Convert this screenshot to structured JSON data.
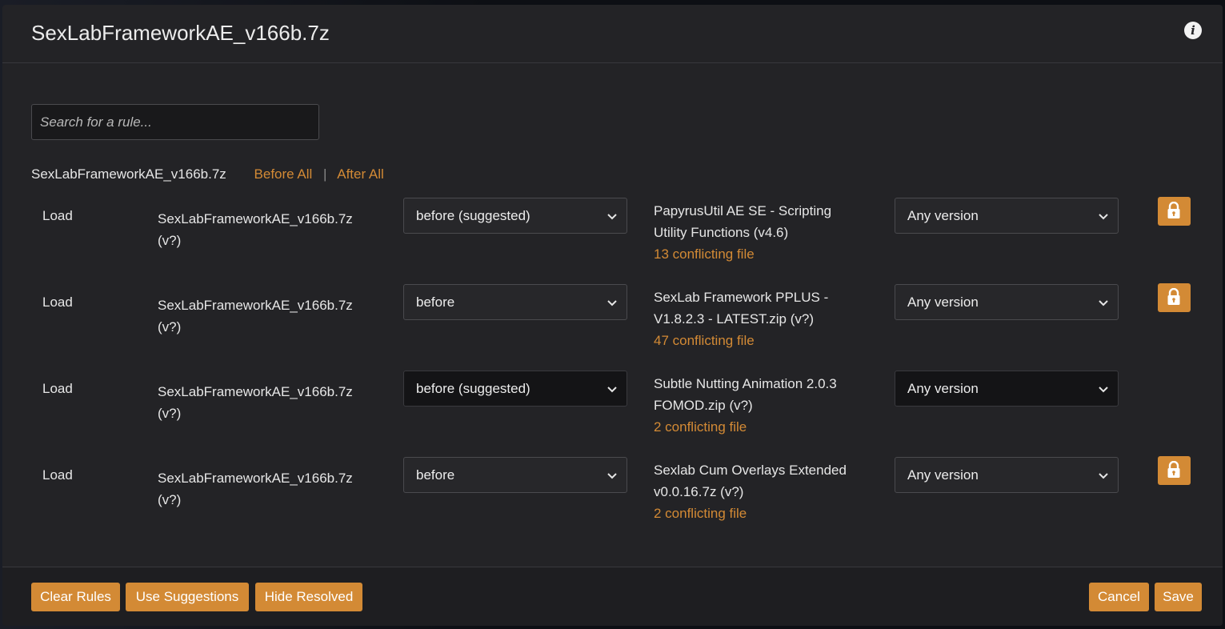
{
  "dialog": {
    "title": "SexLabFrameworkAE_v166b.7z",
    "info_icon": "info-icon"
  },
  "search": {
    "placeholder": "Search for a rule..."
  },
  "subhead": {
    "mod_name": "SexLabFrameworkAE_v166b.7z",
    "before_all": "Before All",
    "separator": "|",
    "after_all": "After All"
  },
  "rules": [
    {
      "verb": "Load",
      "source_name": "SexLabFrameworkAE_v166b.7z",
      "source_version": "(v?)",
      "relation": "before (suggested)",
      "target_line1": "PapyrusUtil AE SE - Scripting",
      "target_line2": "Utility Functions (v4.6)",
      "conflicts": "13 conflicting file",
      "version": "Any version",
      "locked": true
    },
    {
      "verb": "Load",
      "source_name": "SexLabFrameworkAE_v166b.7z",
      "source_version": "(v?)",
      "relation": "before",
      "target_line1": "SexLab Framework PPLUS -",
      "target_line2": "V1.8.2.3 - LATEST.zip (v?)",
      "conflicts": "47 conflicting file",
      "version": "Any version",
      "locked": true
    },
    {
      "verb": "Load",
      "source_name": "SexLabFrameworkAE_v166b.7z",
      "source_version": "(v?)",
      "relation": "before (suggested)",
      "target_line1": "Subtle Nutting Animation 2.0.3",
      "target_line2": "FOMOD.zip (v?)",
      "conflicts": "2 conflicting file",
      "version": "Any version",
      "locked": false
    },
    {
      "verb": "Load",
      "source_name": "SexLabFrameworkAE_v166b.7z",
      "source_version": "(v?)",
      "relation": "before",
      "target_line1": "Sexlab Cum Overlays Extended",
      "target_line2": "v0.0.16.7z (v?)",
      "conflicts": "2 conflicting file",
      "version": "Any version",
      "locked": true
    }
  ],
  "footer": {
    "clear_rules": "Clear Rules",
    "use_suggestions": "Use Suggestions",
    "hide_resolved": "Hide Resolved",
    "cancel": "Cancel",
    "save": "Save"
  },
  "colors": {
    "accent": "#d38a35",
    "dialog_bg": "#232326",
    "text": "#e6e6e6"
  }
}
